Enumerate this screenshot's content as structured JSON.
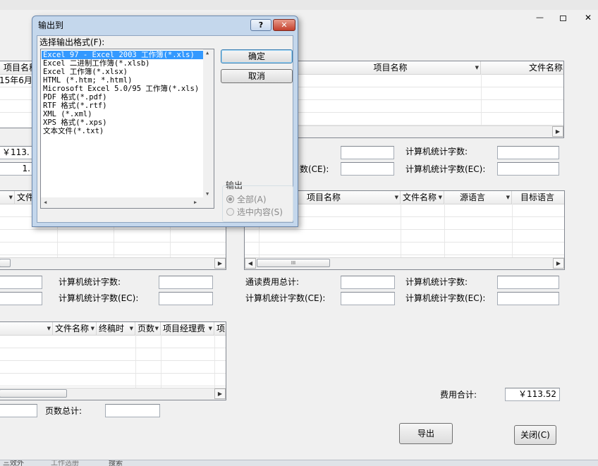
{
  "window": {
    "minimize_glyph": "—",
    "restore_glyph": "▫",
    "close_glyph": "✕"
  },
  "dialog": {
    "title": "输出到",
    "help_glyph": "?",
    "close_glyph": "✕",
    "format_label": "选择输出格式(F):",
    "formats": [
      "Excel 97 - Excel 2003 工作簿(*.xls)",
      "Excel 二进制工作簿(*.xlsb)",
      "Excel 工作簿(*.xlsx)",
      "HTML (*.htm; *.html)",
      "Microsoft Excel 5.0/95 工作簿(*.xls)",
      "PDF 格式(*.pdf)",
      "RTF 格式(*.rtf)",
      "XML (*.xml)",
      "XPS 格式(*.xps)",
      "文本文件(*.txt)"
    ],
    "selected_index": 0,
    "ok_label": "确定",
    "cancel_label": "取消",
    "output_group_label": "输出",
    "radio_all": "全部(A)",
    "radio_selection": "选中内容(S)"
  },
  "top_left_grid": {
    "header_partial": "项目名称",
    "row1_partial": "15年6月—"
  },
  "top_right_grid": {
    "col1": "项目名称",
    "col2": "文件名称"
  },
  "fields1": {
    "amount_value": "￥113.",
    "count_value": "1.",
    "stat_label": "计算机统计字数:",
    "stat_ce_partial": "数(CE):",
    "stat_ec_label": "计算机统计字数(EC):"
  },
  "mid_left_grid": {
    "col_partial": "文件"
  },
  "mid_right_grid": {
    "col1": "项目名称",
    "col2": "文件名称",
    "col3": "源语言",
    "col4": "目标语言",
    "thumb_grip": "III"
  },
  "fields2": {
    "left_stat": "计算机统计字数:",
    "left_stat_ec": "计算机统计字数(EC):",
    "right_total": "通读费用总计:",
    "right_stat_ce": "计算机统计字数(CE):",
    "right_stat": "计算机统计字数:",
    "right_stat_ec": "计算机统计字数(EC):"
  },
  "bottom_grid": {
    "col1": "文件名称",
    "col2": "终稿时",
    "col3": "页数",
    "col4": "项目经理费",
    "col5": "项"
  },
  "bottom": {
    "pages_total_label": "页数总计:",
    "fee_total_label": "费用合计:",
    "fee_total_value": "￥113.52",
    "export_label": "导出",
    "close_label": "关闭(C)"
  },
  "taskbar": {
    "item1": "三效外",
    "item2": "工作选册",
    "item3": "搜索"
  }
}
